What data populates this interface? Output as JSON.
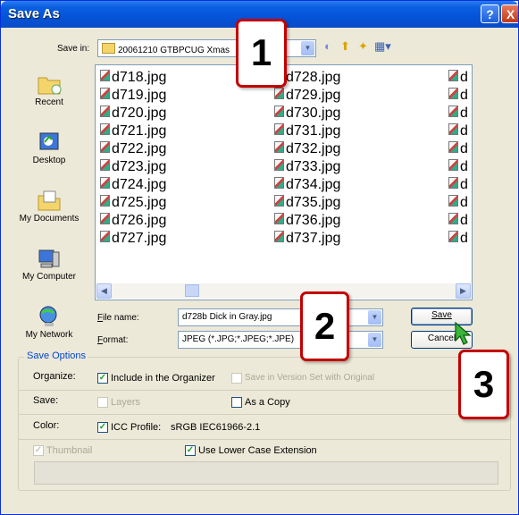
{
  "window": {
    "title": "Save As",
    "help": "?",
    "close": "X"
  },
  "save_in": {
    "label": "Save in:",
    "value": "20061210 GTBPCUG Xmas"
  },
  "places": [
    {
      "id": "recent",
      "label": "Recent"
    },
    {
      "id": "desktop",
      "label": "Desktop"
    },
    {
      "id": "documents",
      "label": "My Documents"
    },
    {
      "id": "computer",
      "label": "My Computer"
    },
    {
      "id": "network",
      "label": "My Network"
    }
  ],
  "files": {
    "col1": [
      "d718.jpg",
      "d719.jpg",
      "d720.jpg",
      "d721.jpg",
      "d722.jpg",
      "d723.jpg",
      "d724.jpg",
      "d725.jpg",
      "d726.jpg",
      "d727.jpg"
    ],
    "col2": [
      "d728.jpg",
      "d729.jpg",
      "d730.jpg",
      "d731.jpg",
      "d732.jpg",
      "d733.jpg",
      "d734.jpg",
      "d735.jpg",
      "d736.jpg",
      "d737.jpg"
    ],
    "col3": [
      "d",
      "d",
      "d",
      "d",
      "d",
      "d",
      "d",
      "d",
      "d",
      "d"
    ]
  },
  "file_name": {
    "label": "File name:",
    "value": "d728b Dick in Gray.jpg"
  },
  "format": {
    "label": "Format:",
    "value": "JPEG (*.JPG;*.JPEG;*.JPE)"
  },
  "buttons": {
    "save": "Save",
    "cancel": "Cancel"
  },
  "callouts": {
    "one": "1",
    "two": "2",
    "three": "3"
  },
  "options": {
    "legend": "Save Options",
    "organize_label": "Organize:",
    "include_organizer": "Include in the Organizer",
    "version_set": "Save in Version Set with Original",
    "save_label": "Save:",
    "layers": "Layers",
    "as_copy": "As a Copy",
    "color_label": "Color:",
    "icc_profile": "ICC Profile:",
    "icc_value": "sRGB IEC61966-2.1",
    "thumbnail": "Thumbnail",
    "lower_case": "Use Lower Case Extension"
  },
  "colors": {
    "title_bar": "#0553d8",
    "callout_border": "#c40000",
    "legend": "#0046d5"
  }
}
